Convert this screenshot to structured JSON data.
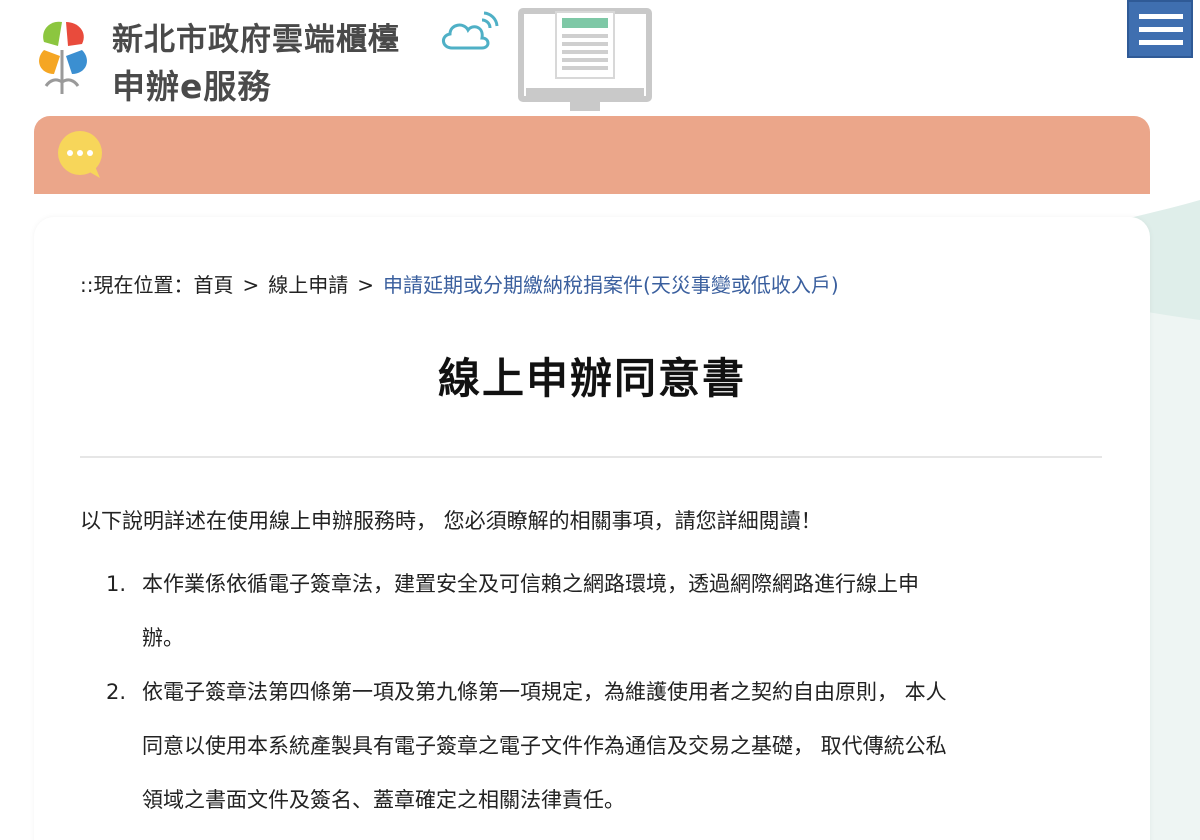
{
  "header": {
    "site_title": "新北市政府雲端櫃檯",
    "site_subtitle": "申辦e服務",
    "icons": [
      "logo-mark",
      "cloud-wifi-icon",
      "monitor-document-icon",
      "menu-icon"
    ]
  },
  "banner": {
    "icon": "chat-bubble-icon",
    "color": "#eba68a"
  },
  "breadcrumb": {
    "prefix": "::現在位置：",
    "home": "首頁",
    "separator": ">",
    "level2": "線上申請",
    "current": "申請延期或分期繳納稅捐案件(天災事變或低收入戶)"
  },
  "page_title": "線上申辦同意書",
  "intro": "以下說明詳述在使用線上申辦服務時， 您必須瞭解的相關事項，請您詳細閱讀！",
  "terms": [
    {
      "num": "1.",
      "lines": [
        "本作業係依循電子簽章法，建置安全及可信賴之網路環境，透過網際網路進行線上申",
        "辦。"
      ]
    },
    {
      "num": "2.",
      "lines": [
        "依電子簽章法第四條第一項及第九條第一項規定，為維護使用者之契約自由原則， 本人",
        "同意以使用本系統產製具有電子簽章之電子文件作為通信及交易之基礎， 取代傳統公私",
        "領域之書面文件及簽名、蓋章確定之相關法律責任。"
      ]
    }
  ],
  "colors": {
    "menu_button": "#3f6fb0",
    "banner": "#eba68a",
    "breadcrumb_current": "#3a5f9e"
  }
}
